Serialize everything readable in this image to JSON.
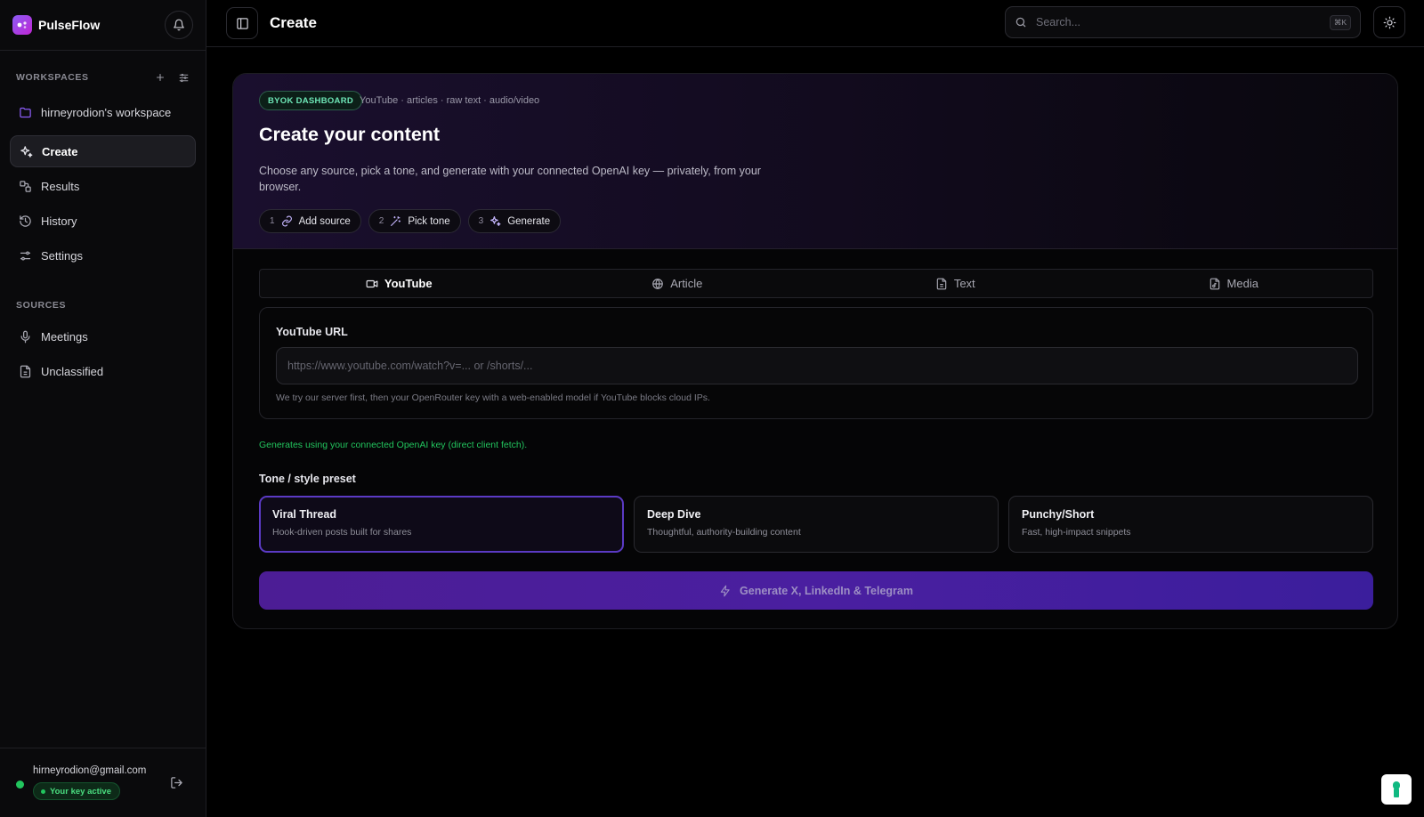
{
  "brand": {
    "name": "PulseFlow"
  },
  "sidebar": {
    "workspaces_label": "WORKSPACES",
    "workspace_name": "hirneyrodion's workspace",
    "nav": [
      {
        "label": "Create",
        "icon": "sparkles-icon",
        "active": true
      },
      {
        "label": "Results",
        "icon": "results-icon",
        "active": false
      },
      {
        "label": "History",
        "icon": "history-icon",
        "active": false
      },
      {
        "label": "Settings",
        "icon": "sliders-icon",
        "active": false
      }
    ],
    "sources_label": "SOURCES",
    "sources": [
      {
        "label": "Meetings",
        "icon": "microphone-icon"
      },
      {
        "label": "Unclassified",
        "icon": "document-icon"
      }
    ]
  },
  "user": {
    "email": "hirneyrodion@gmail.com",
    "key_status": "Your key active",
    "status_color": "#22c55e"
  },
  "topbar": {
    "title": "Create",
    "search_placeholder": "Search...",
    "search_shortcut": "⌘K"
  },
  "hero": {
    "badge": "BYOK DASHBOARD",
    "badge_sub": "YouTube · articles · raw text · audio/video",
    "title": "Create your content",
    "description": "Choose any source, pick a tone, and generate with your connected OpenAI key — privately, from your browser.",
    "steps": [
      {
        "num": "1",
        "label": "Add source",
        "icon": "link-icon"
      },
      {
        "num": "2",
        "label": "Pick tone",
        "icon": "wand-icon"
      },
      {
        "num": "3",
        "label": "Generate",
        "icon": "sparkles-icon"
      }
    ]
  },
  "tabs": [
    {
      "label": "YouTube",
      "icon": "video-icon",
      "active": true
    },
    {
      "label": "Article",
      "icon": "globe-icon",
      "active": false
    },
    {
      "label": "Text",
      "icon": "document-icon",
      "active": false
    },
    {
      "label": "Media",
      "icon": "media-file-icon",
      "active": false
    }
  ],
  "youtube": {
    "label": "YouTube URL",
    "value": "",
    "placeholder": "https://www.youtube.com/watch?v=... or /shorts/...",
    "hint": "We try our server first, then your OpenRouter key with a web-enabled model if YouTube blocks cloud IPs."
  },
  "generation_note": "Generates using your connected OpenAI key (direct client fetch).",
  "tone": {
    "label": "Tone / style preset",
    "presets": [
      {
        "title": "Viral Thread",
        "desc": "Hook-driven posts built for shares",
        "selected": true
      },
      {
        "title": "Deep Dive",
        "desc": "Thoughtful, authority-building content",
        "selected": false
      },
      {
        "title": "Punchy/Short",
        "desc": "Fast, high-impact snippets",
        "selected": false
      }
    ]
  },
  "generate_button": "Generate X, LinkedIn & Telegram",
  "colors": {
    "accent": "#7c3aed",
    "success": "#22c55e",
    "background": "#000000"
  }
}
